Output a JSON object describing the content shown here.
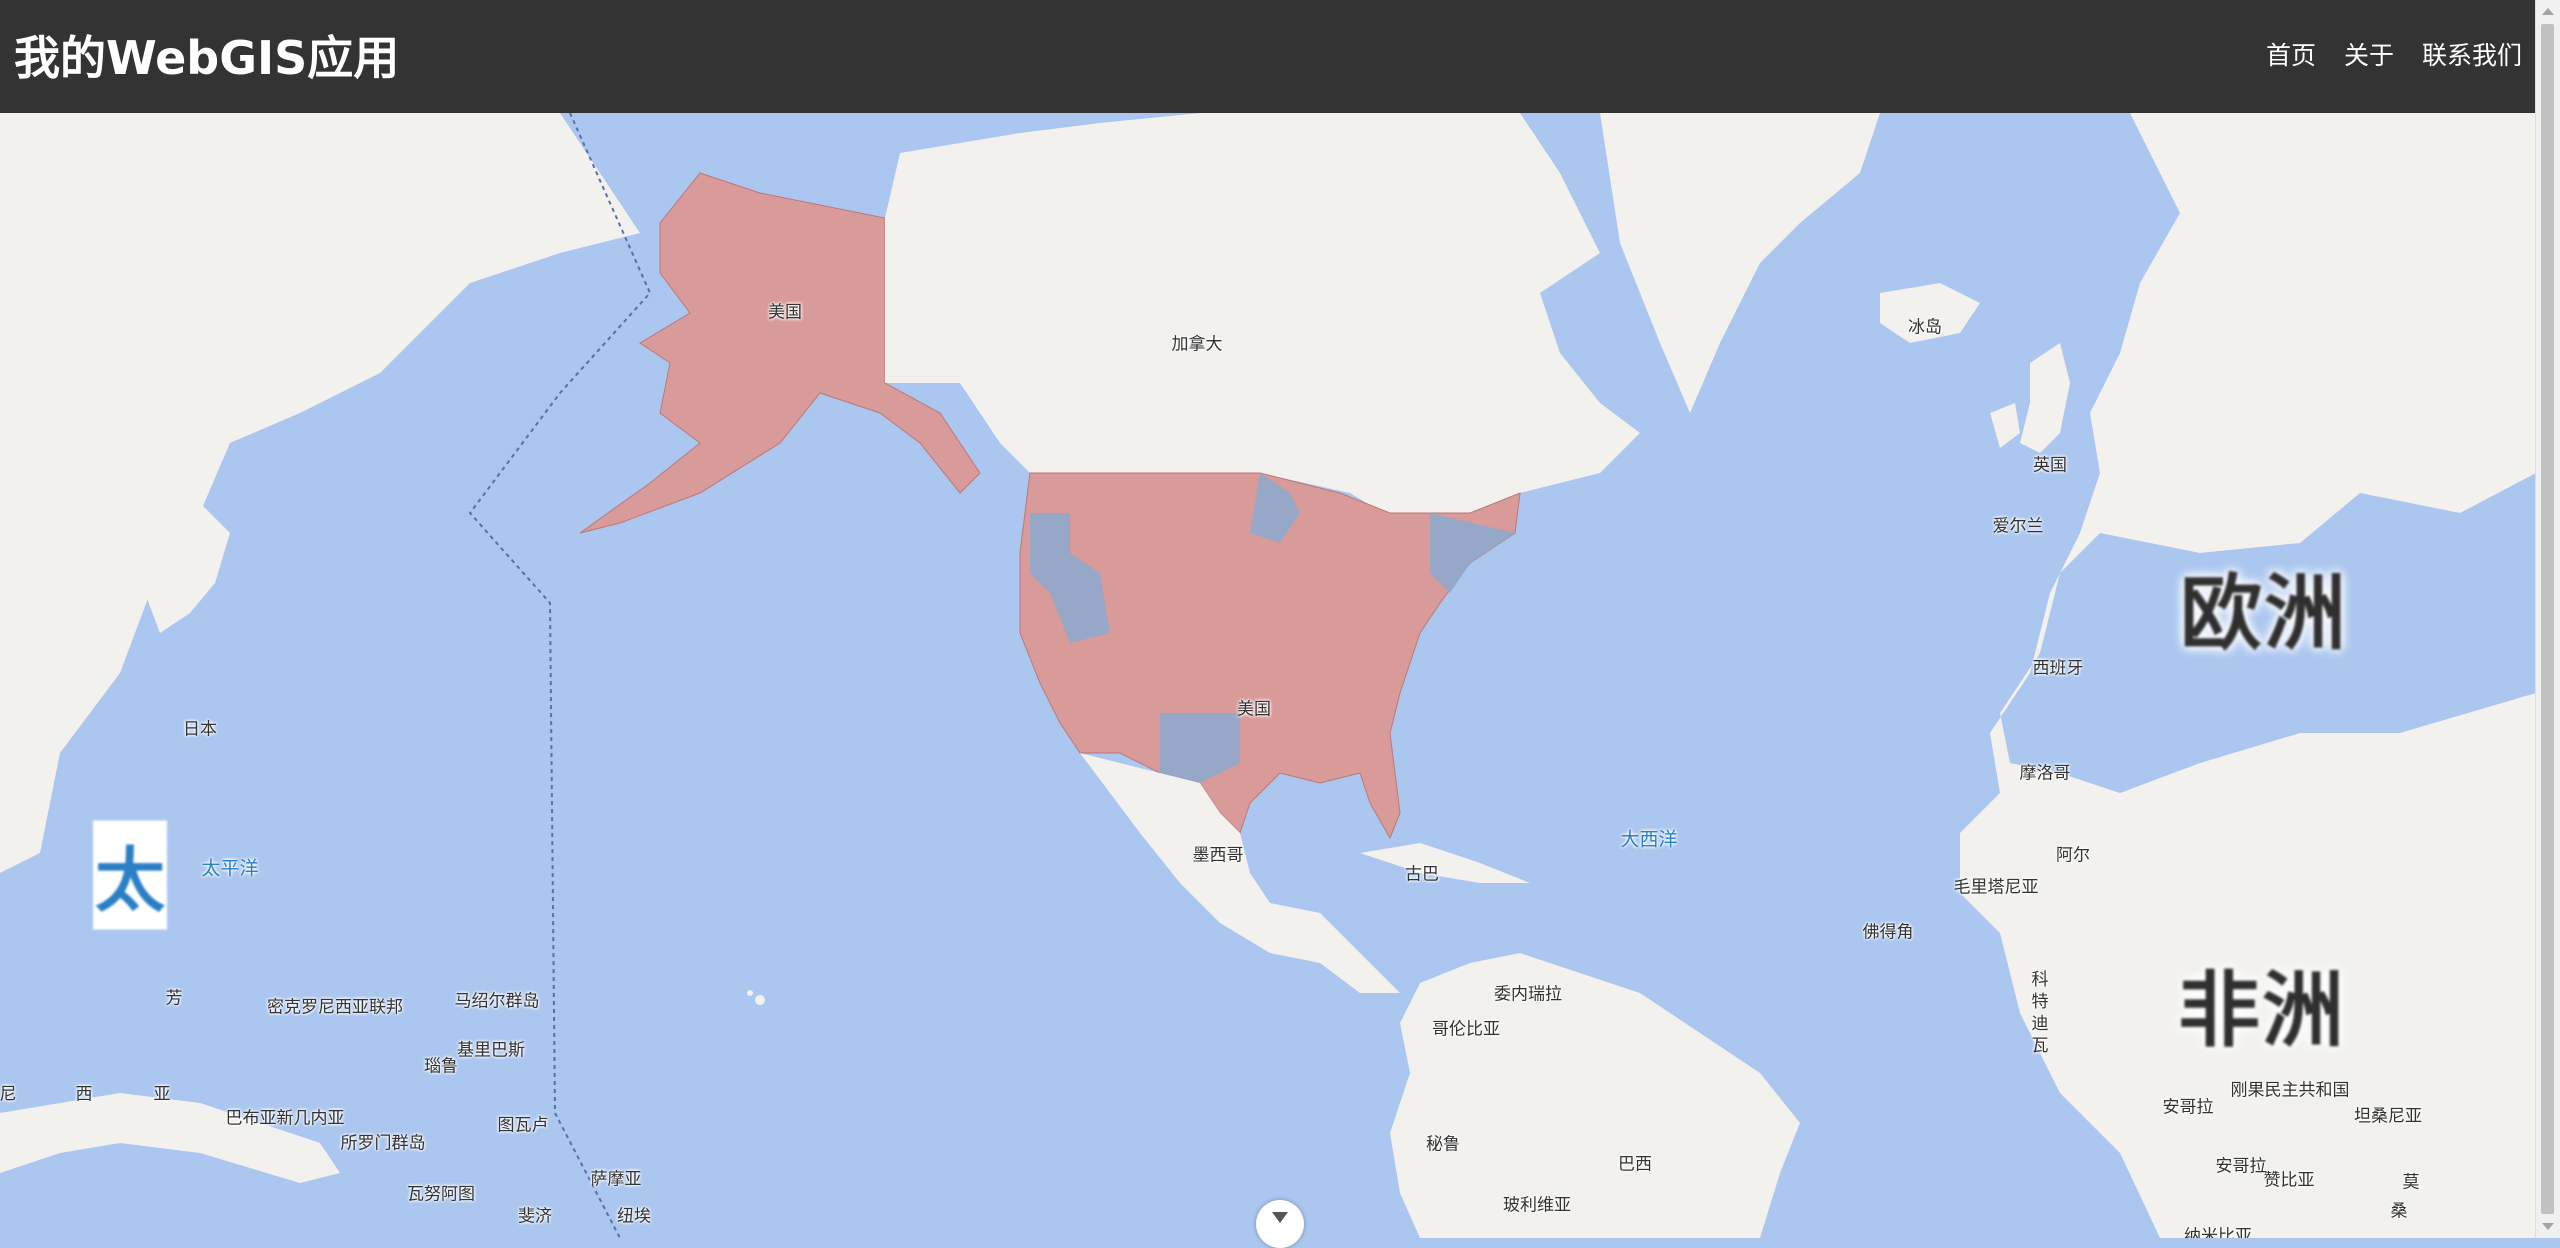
{
  "header": {
    "title": "我的WebGIS应用",
    "nav": [
      "首页",
      "关于",
      "联系我们"
    ]
  },
  "map": {
    "labels": {
      "us_alaska": "美国",
      "canada": "加拿大",
      "iceland": "冰岛",
      "uk": "英国",
      "ireland": "爱尔兰",
      "spain": "西班牙",
      "morocco": "摩洛哥",
      "mauritania": "毛里塔尼亚",
      "algeria_partial": "阿尔",
      "ivory_coast_partial": "科\n特\n迪\n瓦",
      "us": "美国",
      "mexico": "墨西哥",
      "cuba": "古巴",
      "venezuela": "委内瑞拉",
      "colombia": "哥伦比亚",
      "peru": "秘鲁",
      "bolivia": "玻利维亚",
      "brazil": "巴西",
      "japan": "日本",
      "micronesia": "密克罗尼西亚联邦",
      "marshall": "马绍尔群岛",
      "kiribati": "基里巴斯",
      "nauru": "瑙鲁",
      "png": "巴布亚新几内亚",
      "solomon": "所罗门群岛",
      "tuvalu": "图瓦卢",
      "vanuatu": "瓦努阿图",
      "fiji": "斐济",
      "samoa": "萨摩亚",
      "tonga": "纽埃",
      "angola": "安哥拉",
      "drc": "刚果民主共和国",
      "tanzania": "坦桑尼亚",
      "zambia": "赞比亚",
      "mozambique": "莫",
      "mozambique2": "桑",
      "buffer_partial": "佛得角",
      "philippines_partial": "芳",
      "ni_partial": "尼",
      "xi_partial": "西",
      "ya_partial": "亚",
      "namibia_partial": "纳米比亚"
    },
    "ocean_labels": {
      "pacific": "太平洋",
      "atlantic": "大西洋"
    },
    "overlay_labels": {
      "pacific_big": "太",
      "europe": "欧洲",
      "africa": "非洲"
    },
    "colors": {
      "water": "#abc6ef",
      "land": "#f2f1ed",
      "choropleth_red": "#d99b99",
      "choropleth_blue": "#8fa8cc"
    }
  }
}
